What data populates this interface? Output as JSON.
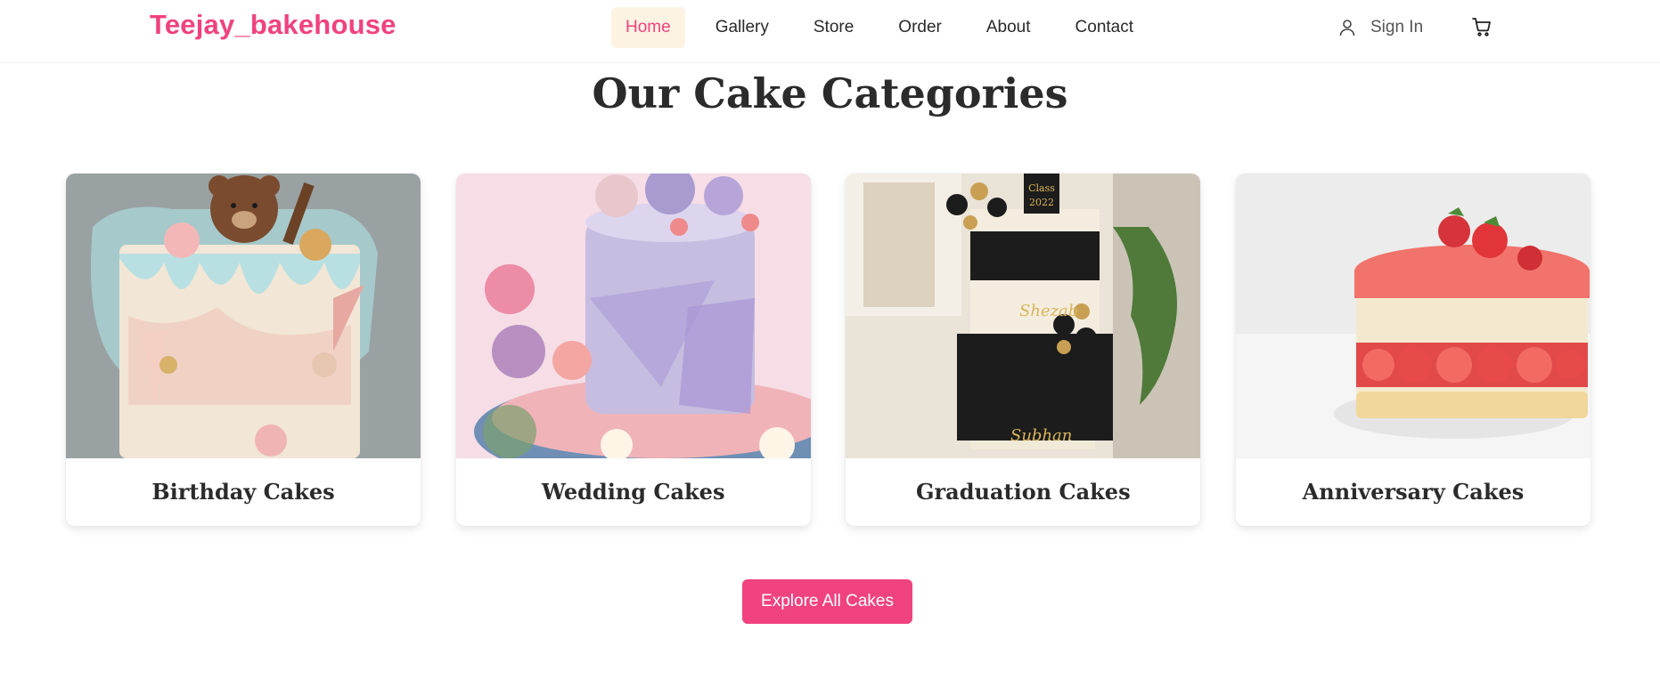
{
  "brand": {
    "name": "Teejay_bakehouse",
    "color": "#f0427f"
  },
  "nav": {
    "items": [
      {
        "label": "Home",
        "active": true
      },
      {
        "label": "Gallery",
        "active": false
      },
      {
        "label": "Store",
        "active": false
      },
      {
        "label": "Order",
        "active": false
      },
      {
        "label": "About",
        "active": false
      },
      {
        "label": "Contact",
        "active": false
      }
    ],
    "signin_label": "Sign In",
    "user_icon": "user-icon",
    "cart_icon": "cart-icon"
  },
  "section": {
    "title": "Our Cake Categories",
    "categories": [
      {
        "label": "Birthday Cakes",
        "image": "birthday-cake-image"
      },
      {
        "label": "Wedding Cakes",
        "image": "wedding-cake-image"
      },
      {
        "label": "Graduation Cakes",
        "image": "graduation-cake-image"
      },
      {
        "label": "Anniversary Cakes",
        "image": "anniversary-cake-image"
      }
    ],
    "cta_label": "Explore All Cakes"
  },
  "colors": {
    "accent": "#f0427f",
    "active_nav_bg": "#fdf3e2"
  }
}
